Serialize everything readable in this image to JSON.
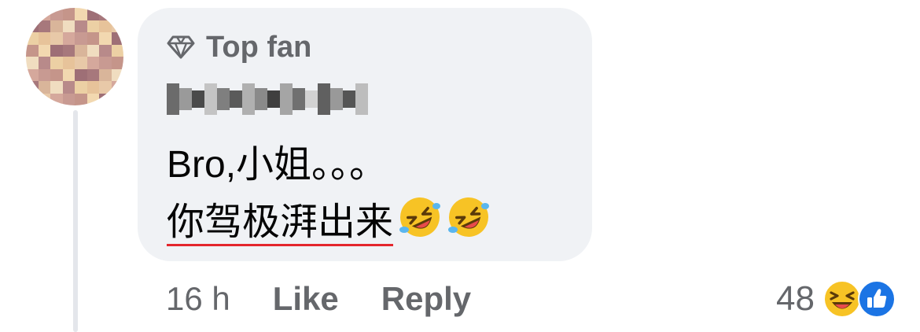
{
  "comment": {
    "badge_label": "Top fan",
    "line1": "Bro,小姐。。。",
    "line2_text": "你驾极湃出来",
    "emojis": [
      "rolling-on-the-floor-laughing",
      "rolling-on-the-floor-laughing"
    ]
  },
  "actions": {
    "time": "16 h",
    "like_label": "Like",
    "reply_label": "Reply"
  },
  "reactions": {
    "count": "48",
    "icons": [
      "laughing-emoji",
      "thumbs-up"
    ]
  },
  "colors": {
    "bubble_bg": "#f0f2f5",
    "secondary_text": "#65676b",
    "primary_text": "#050505",
    "spellcheck_underline": "#e4262c",
    "like_blue": "#1b74e4"
  }
}
